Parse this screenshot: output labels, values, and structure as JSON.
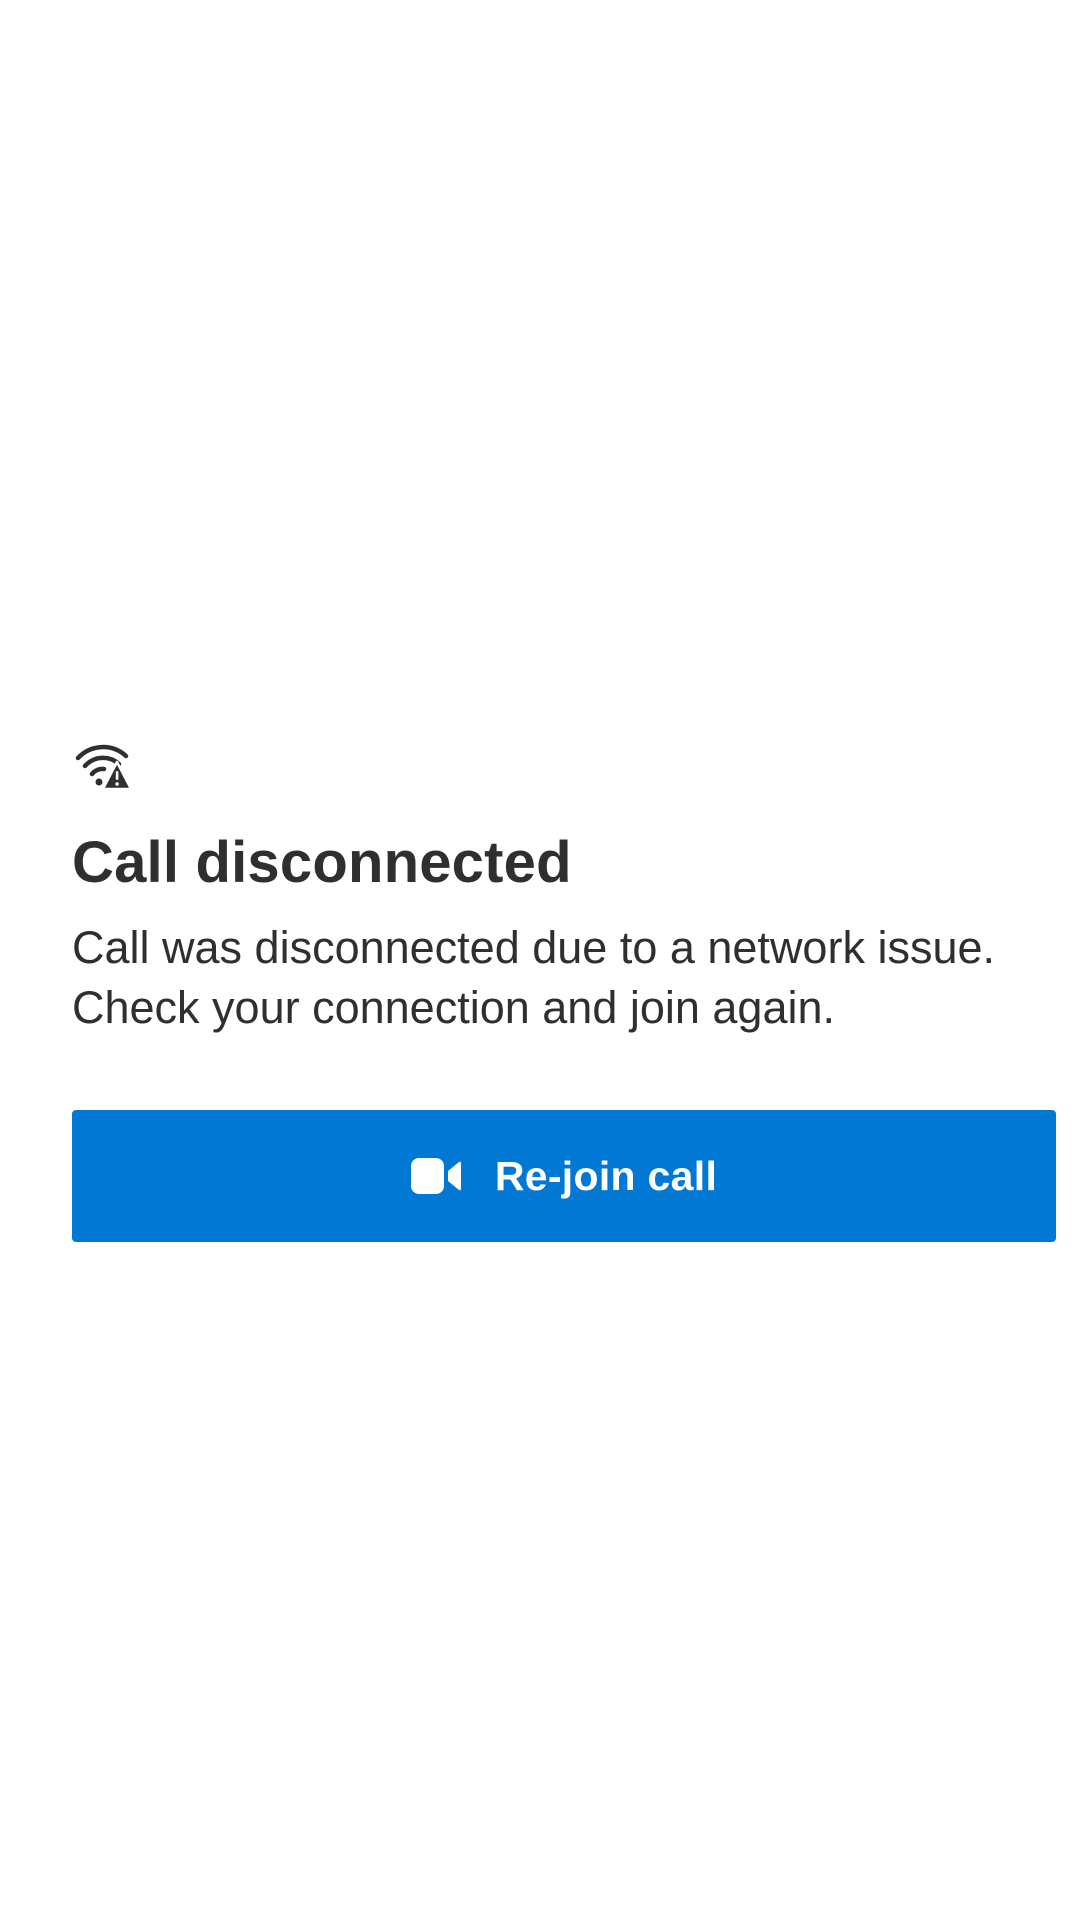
{
  "screen": {
    "status_icon": "wifi-warning-icon",
    "title": "Call disconnected",
    "message_lines": [
      "Call was disconnected due to a network issue.",
      "Check your connection and join again."
    ]
  },
  "actions": {
    "rejoin_button": {
      "icon": "video-camera-icon",
      "label": "Re-join call"
    }
  },
  "colors": {
    "accent": "#0078d4",
    "text": "#2f2f2f",
    "background": "#ffffff",
    "button_text": "#ffffff"
  }
}
